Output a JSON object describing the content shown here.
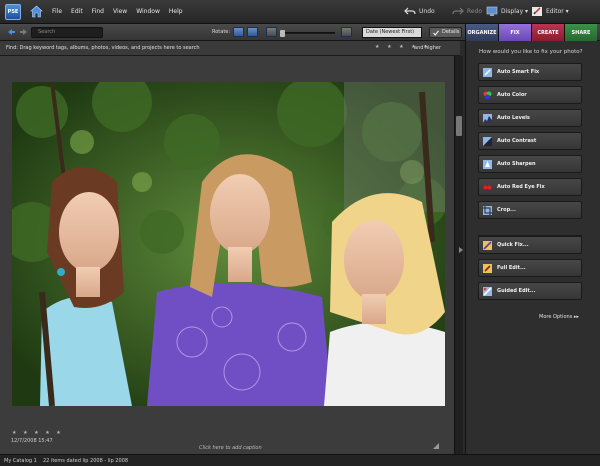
{
  "app": {
    "logo_text": "PSE"
  },
  "menu": [
    "File",
    "Edit",
    "Find",
    "View",
    "Window",
    "Help"
  ],
  "topbar": {
    "undo": "Undo",
    "redo": "Redo",
    "display": "Display ▾",
    "editor": "Editor ▾"
  },
  "toolbar": {
    "search_placeholder": "Search",
    "rotate_label": "Rotate:",
    "sort_value": "Date (Newest First)",
    "details_label": "Details"
  },
  "tabs": [
    {
      "label": "ORGANIZE",
      "color": "#3c4a6e"
    },
    {
      "label": "FIX",
      "color": "#7b57c4"
    },
    {
      "label": "CREATE",
      "color": "#a0243a"
    },
    {
      "label": "SHARE",
      "color": "#2f7a3a"
    }
  ],
  "findbar": {
    "text": "Find: Drag keyword tags, albums, photos, videos, and projects here to search",
    "stars": "★ ★ ★ ★ ★",
    "higher": "and higher"
  },
  "photo": {
    "rating": "★ ★ ★ ★ ★",
    "date": "12/7/2008 15:47",
    "caption": "Click here to add caption"
  },
  "fix_panel": {
    "question": "How would you like to fix your photo?",
    "buttons": [
      {
        "label": "Auto Smart Fix",
        "icon": "smart-fix-icon"
      },
      {
        "label": "Auto Color",
        "icon": "color-icon"
      },
      {
        "label": "Auto Levels",
        "icon": "levels-icon"
      },
      {
        "label": "Auto Contrast",
        "icon": "contrast-icon"
      },
      {
        "label": "Auto Sharpen",
        "icon": "sharpen-icon"
      },
      {
        "label": "Auto Red Eye Fix",
        "icon": "red-eye-icon"
      },
      {
        "label": "Crop...",
        "icon": "crop-icon"
      },
      {
        "label": "Quick Fix...",
        "icon": "quick-fix-icon"
      },
      {
        "label": "Full Edit...",
        "icon": "full-edit-icon"
      },
      {
        "label": "Guided Edit...",
        "icon": "guided-edit-icon"
      }
    ],
    "more_options": "More Options ▸▸"
  },
  "status": {
    "catalog": "My Catalog 1",
    "items": "22 items dated lip 2008 - lip 2008"
  }
}
